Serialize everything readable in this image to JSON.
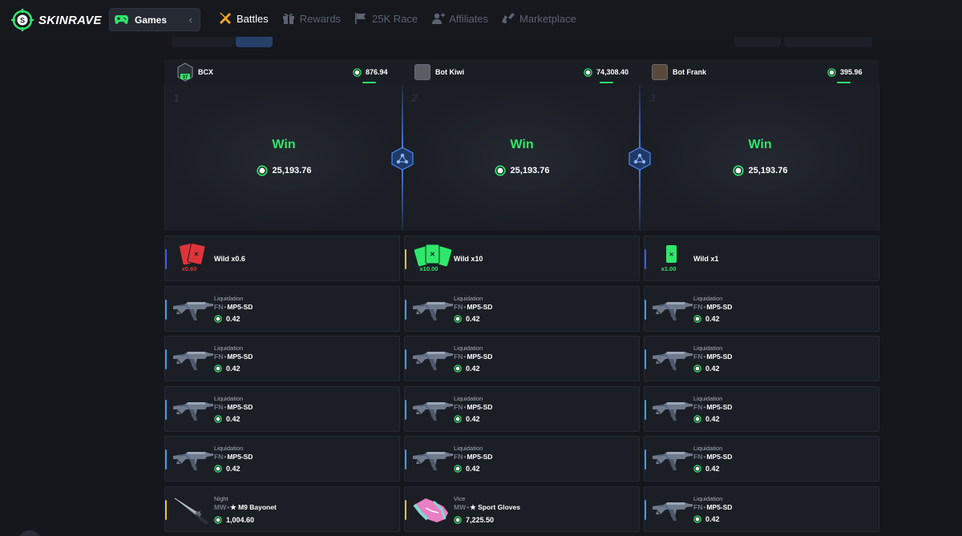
{
  "brand": {
    "name_a": "SKIN",
    "name_b": "RAVE"
  },
  "games_button": {
    "label": "Games"
  },
  "nav": [
    {
      "label": "Battles",
      "icon": "battles-icon",
      "active": true
    },
    {
      "label": "Rewards",
      "icon": "gift-icon",
      "active": false
    },
    {
      "label": "25K Race",
      "icon": "flag-icon",
      "active": false
    },
    {
      "label": "Affiliates",
      "icon": "add-user-icon",
      "active": false
    },
    {
      "label": "Marketplace",
      "icon": "marketplace-icon",
      "active": false
    }
  ],
  "players": [
    {
      "name": "BCX",
      "level": "37",
      "value": "876.94"
    },
    {
      "name": "Bot Kiwi",
      "value": "74,308.40"
    },
    {
      "name": "Bot Frank",
      "value": "395.96"
    }
  ],
  "results": [
    {
      "slot": "1",
      "status": "Win",
      "amount": "25,193.76"
    },
    {
      "slot": "2",
      "status": "Win",
      "amount": "25,193.76"
    },
    {
      "slot": "3",
      "status": "Win",
      "amount": "25,193.76"
    }
  ],
  "columns": [
    [
      {
        "type": "wild",
        "name": "Wild x0.6",
        "mult": "x0.60",
        "color": "#e0343b"
      },
      {
        "type": "gun",
        "cat": "Liquidation",
        "cond": "FN",
        "name": "MP5-SD",
        "price": "0.42",
        "accent": "#3aa0ff"
      },
      {
        "type": "gun",
        "cat": "Liquidation",
        "cond": "FN",
        "name": "MP5-SD",
        "price": "0.42",
        "accent": "#3aa0ff"
      },
      {
        "type": "gun",
        "cat": "Liquidation",
        "cond": "FN",
        "name": "MP5-SD",
        "price": "0.42",
        "accent": "#3aa0ff"
      },
      {
        "type": "gun",
        "cat": "Liquidation",
        "cond": "FN",
        "name": "MP5-SD",
        "price": "0.42",
        "accent": "#3aa0ff"
      },
      {
        "type": "knife",
        "cat": "Night",
        "cond": "MW",
        "name": "★ M9 Bayonet",
        "price": "1,004.60",
        "accent": "#f2c230"
      }
    ],
    [
      {
        "type": "wild",
        "name": "Wild x10",
        "mult": "x10.00",
        "color": "#2ee86b"
      },
      {
        "type": "gun",
        "cat": "Liquidation",
        "cond": "FN",
        "name": "MP5-SD",
        "price": "0.42",
        "accent": "#3aa0ff"
      },
      {
        "type": "gun",
        "cat": "Liquidation",
        "cond": "FN",
        "name": "MP5-SD",
        "price": "0.42",
        "accent": "#3aa0ff"
      },
      {
        "type": "gun",
        "cat": "Liquidation",
        "cond": "FN",
        "name": "MP5-SD",
        "price": "0.42",
        "accent": "#3aa0ff"
      },
      {
        "type": "gun",
        "cat": "Liquidation",
        "cond": "FN",
        "name": "MP5-SD",
        "price": "0.42",
        "accent": "#3aa0ff"
      },
      {
        "type": "gloves",
        "cat": "Vice",
        "cond": "MW",
        "name": "★ Sport Gloves",
        "price": "7,225.50",
        "accent": "#f2c230"
      }
    ],
    [
      {
        "type": "wild",
        "name": "Wild x1",
        "mult": "x1.00",
        "color": "#2ee86b"
      },
      {
        "type": "gun",
        "cat": "Liquidation",
        "cond": "FN",
        "name": "MP5-SD",
        "price": "0.42",
        "accent": "#3aa0ff"
      },
      {
        "type": "gun",
        "cat": "Liquidation",
        "cond": "FN",
        "name": "MP5-SD",
        "price": "0.42",
        "accent": "#3aa0ff"
      },
      {
        "type": "gun",
        "cat": "Liquidation",
        "cond": "FN",
        "name": "MP5-SD",
        "price": "0.42",
        "accent": "#3aa0ff"
      },
      {
        "type": "gun",
        "cat": "Liquidation",
        "cond": "FN",
        "name": "MP5-SD",
        "price": "0.42",
        "accent": "#3aa0ff"
      },
      {
        "type": "gun",
        "cat": "Liquidation",
        "cond": "FN",
        "name": "MP5-SD",
        "price": "0.42",
        "accent": "#3aa0ff"
      }
    ]
  ],
  "colors": {
    "accent_green": "#2ee86b",
    "divider_blue": "#4d86ff",
    "wild_red": "#e0343b",
    "rarity_blue": "#3aa0ff",
    "rarity_gold": "#f2c230"
  }
}
